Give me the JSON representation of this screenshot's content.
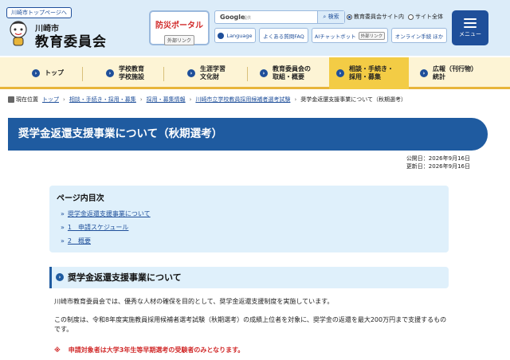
{
  "header": {
    "top_link": "川崎市トップページへ",
    "logo_small": "川崎市",
    "logo_big": "教育委員会",
    "disaster": {
      "label": "防災ポータル",
      "ext": "外部リンク"
    },
    "search": {
      "google": "Google",
      "sub": "提供",
      "button": "検索"
    },
    "radios": [
      {
        "label": "教育委員会サイト内",
        "checked": true
      },
      {
        "label": "サイト全体",
        "checked": false
      }
    ],
    "buttons": [
      {
        "label": "Language",
        "ext": ""
      },
      {
        "label": "よくある質問FAQ",
        "ext": ""
      },
      {
        "label": "AIチャットボット",
        "ext": "外部リンク"
      },
      {
        "label": "オンライン手続 ほか",
        "ext": ""
      }
    ],
    "menu_label": "メニュー"
  },
  "gnav": [
    {
      "label": "トップ"
    },
    {
      "label": "学校教育\n学校施設"
    },
    {
      "label": "生涯学習\n文化財"
    },
    {
      "label": "教育委員会の\n取組・概要"
    },
    {
      "label": "相談・手続き・\n採用・募集"
    },
    {
      "label": "広報（刊行物）\n統計"
    }
  ],
  "breadcrumb": {
    "here": "現在位置",
    "items": [
      "トップ",
      "相談・手続き・採用・募集",
      "採用・募集情報",
      "川崎市立学校教員採用候補者選考試験"
    ],
    "current": "奨学金返還支援事業について（秋期選考）"
  },
  "page_title": "奨学金返還支援事業について（秋期選考）",
  "dates": {
    "published": "公開日：2026年9月16日",
    "updated": "更新日：2026年9月16日"
  },
  "toc": {
    "heading": "ページ内目次",
    "items": [
      {
        "mark": "»",
        "label": "奨学金返還支援事業について"
      },
      {
        "mark": "»",
        "label": "1　申請スケジュール"
      },
      {
        "mark": "»",
        "label": "2　概要"
      }
    ]
  },
  "section": {
    "heading": "奨学金返還支援事業について",
    "para1": "川崎市教育委員会では、優秀な人材の確保を目的として、奨学金返還支援制度を実施しています。",
    "para2": "この制度は、令和8年度実施教員採用候補者選考試験（秋期選考）の成績上位者を対象に、奨学金の返還を最大200万円まで支援するものです。",
    "note_mark": "※",
    "note": "申請対象者は大学3年生等早期選考の受験者のみとなります。"
  }
}
